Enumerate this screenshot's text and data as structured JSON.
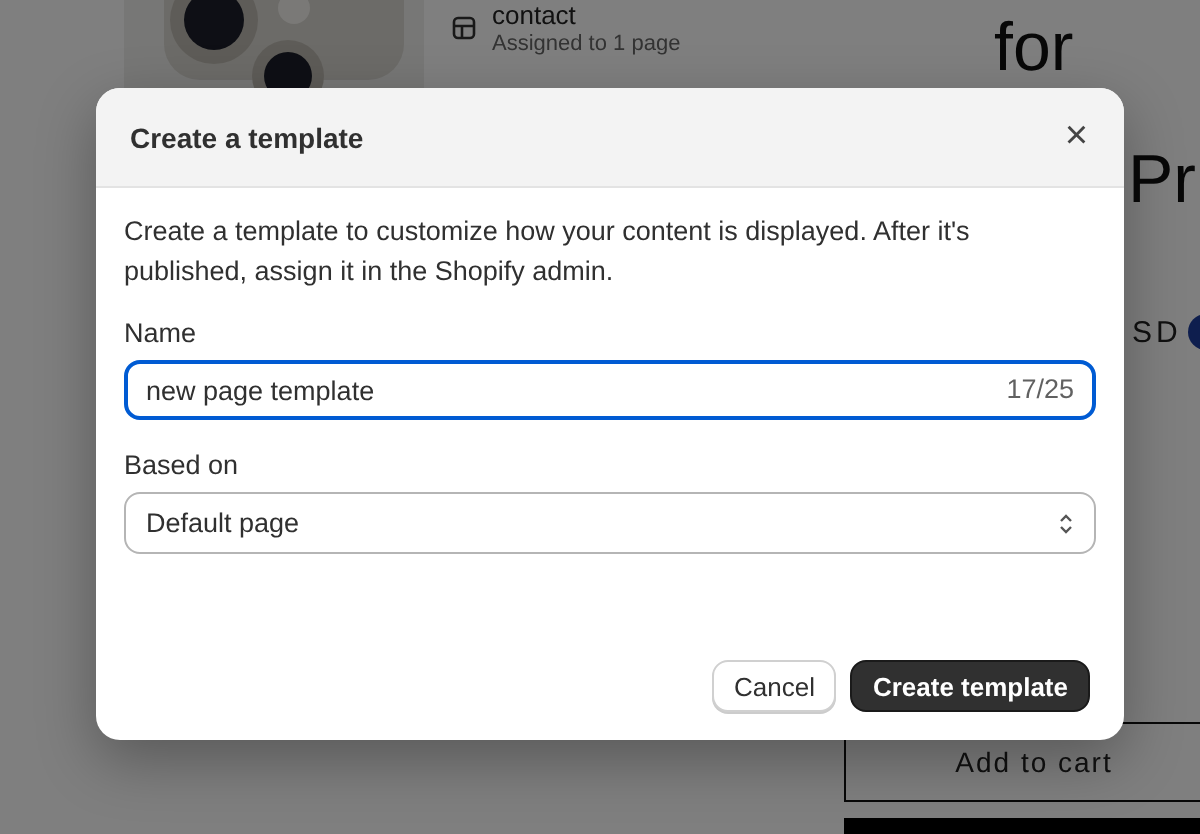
{
  "background": {
    "template_item": {
      "name": "contact",
      "detail": "Assigned to 1 page"
    },
    "headline_lines": [
      "for",
      "Pr"
    ],
    "currency": "SD",
    "add_to_cart": "Add to cart"
  },
  "dialog": {
    "title": "Create a template",
    "close": "×",
    "description": "Create a template to customize how your content is displayed. After it's published, assign it in the Shopify admin.",
    "name_field": {
      "label": "Name",
      "value": "new page template",
      "counter": "17/25",
      "focused": true
    },
    "based_on": {
      "label": "Based on",
      "value": "Default page"
    },
    "buttons": [
      {
        "label": "Cancel",
        "kind": "secondary"
      },
      {
        "label": "Create template",
        "kind": "primary"
      }
    ]
  }
}
